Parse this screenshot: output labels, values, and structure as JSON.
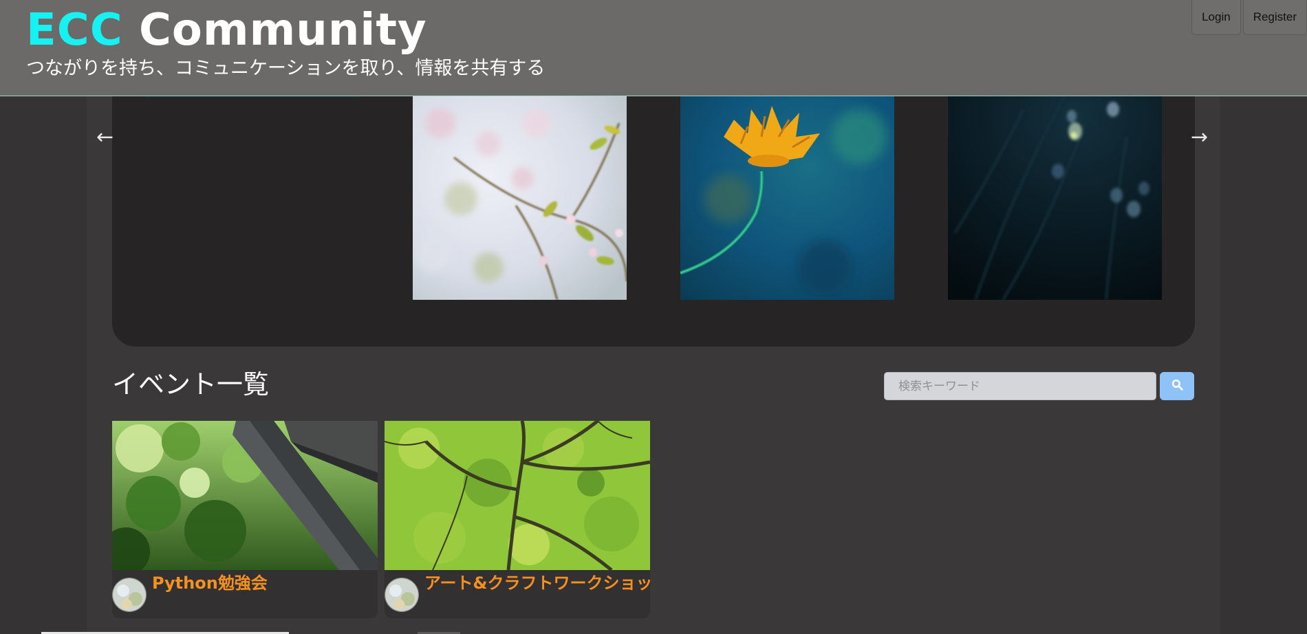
{
  "header": {
    "brand_accent": "ECC",
    "brand_rest": "Community",
    "tagline": "つながりを持ち、コミュニケーションを取り、情報を共有する",
    "login_label": "Login",
    "register_label": "Register"
  },
  "carousel": {
    "prev_arrow": "←",
    "next_arrow": "→",
    "slides": [
      "cherry-blossom-photo",
      "orange-flower-photo",
      "dark-snowdrop-photo"
    ]
  },
  "events": {
    "title": "イベント一覧",
    "search_placeholder": "検索キーワード",
    "cards": [
      {
        "title": "Python勉強会",
        "image": "forest-torii-photo"
      },
      {
        "title": "アート&クラフトワークショップ",
        "image": "green-maple-photo"
      }
    ]
  },
  "colors": {
    "brand_accent": "#16f2f2",
    "event_title": "#f6911f",
    "search_button": "#8fc2f7"
  }
}
